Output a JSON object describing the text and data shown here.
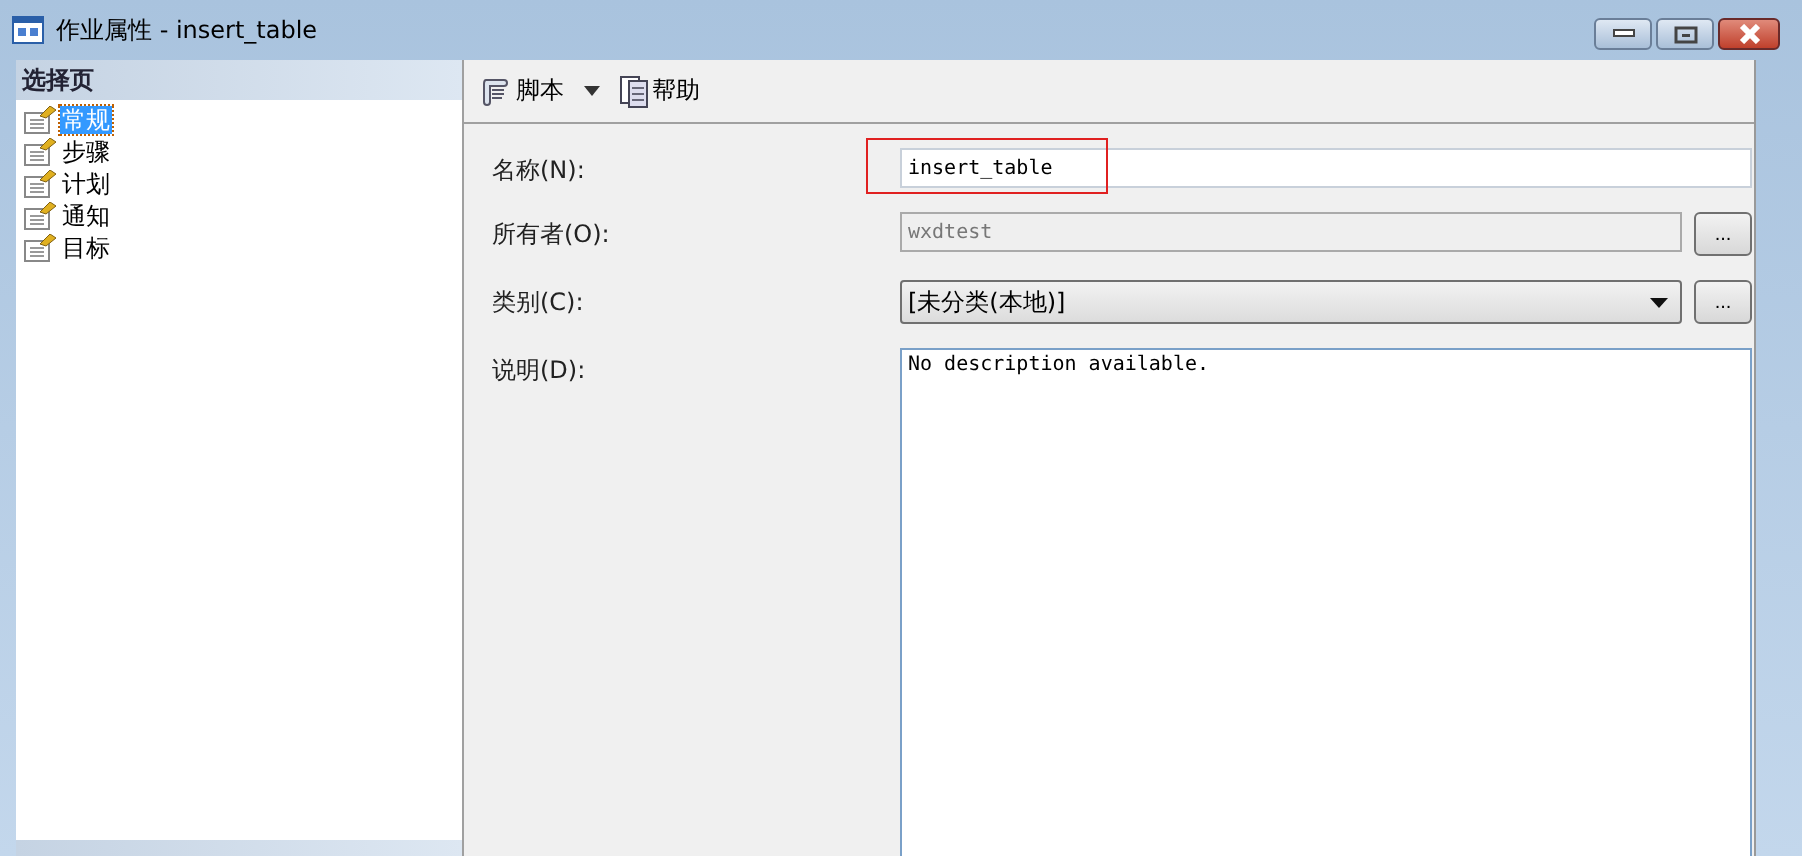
{
  "window": {
    "title": "作业属性 - insert_table"
  },
  "sidebar": {
    "header": "选择页",
    "items": [
      {
        "label": "常规",
        "selected": true
      },
      {
        "label": "步骤",
        "selected": false
      },
      {
        "label": "计划",
        "selected": false
      },
      {
        "label": "通知",
        "selected": false
      },
      {
        "label": "目标",
        "selected": false
      }
    ]
  },
  "toolbar": {
    "script": "脚本",
    "help": "帮助"
  },
  "form": {
    "name_label": "名称(N):",
    "name_value": "insert_table",
    "name_highlighted": true,
    "owner_label": "所有者(O):",
    "owner_value": "wxdtest",
    "owner_button": "...",
    "category_label": "类别(C):",
    "category_value": "[未分类(本地)]",
    "category_button": "...",
    "description_label": "说明(D):",
    "description_value": "No description available."
  }
}
